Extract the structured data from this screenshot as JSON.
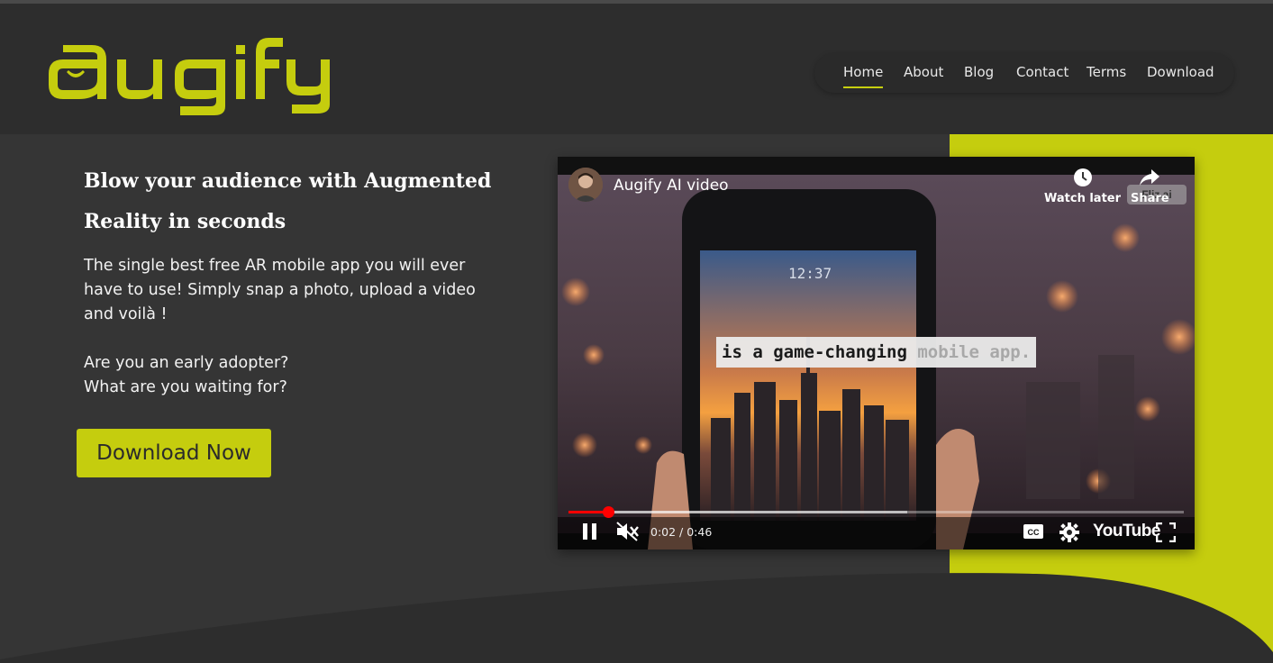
{
  "brand": {
    "logo_text": "augify",
    "accent_color": "#c5cd0e"
  },
  "nav": {
    "items": [
      {
        "label": "Home",
        "active": true
      },
      {
        "label": "About",
        "active": false
      },
      {
        "label": "Blog",
        "active": false
      },
      {
        "label": "Contact",
        "active": false
      },
      {
        "label": "Terms",
        "active": false
      },
      {
        "label": "Download",
        "active": false
      }
    ]
  },
  "hero": {
    "headline": "Blow your audience with Augmented Reality in seconds",
    "paragraph1": "The single best free AR mobile app you will ever have to use! Simply snap a photo, upload a video and voilà !",
    "paragraph2_line1": "Are you an early adopter?",
    "paragraph2_line2": "What are you waiting for?",
    "cta_label": "Download Now"
  },
  "video": {
    "title": "Augify AI video",
    "watch_later_label": "Watch later",
    "share_label": "Share",
    "watermark_text": "Fliz.ai",
    "phone_clock": "12:37",
    "caption_dark": "is a game-changing",
    "caption_light": " mobile app.",
    "time_display": "0:02 / 0:46",
    "youtube_label": "YouTube",
    "played_fraction": 0.065,
    "buffered_fraction": 0.55,
    "state": "playing",
    "muted": true,
    "icons": {
      "pause": "pause-icon",
      "mute": "volume-muted-icon",
      "cc": "closed-captions-icon",
      "settings": "gear-icon",
      "fullscreen": "fullscreen-icon",
      "watch_later": "clock-icon",
      "share": "share-icon"
    }
  }
}
